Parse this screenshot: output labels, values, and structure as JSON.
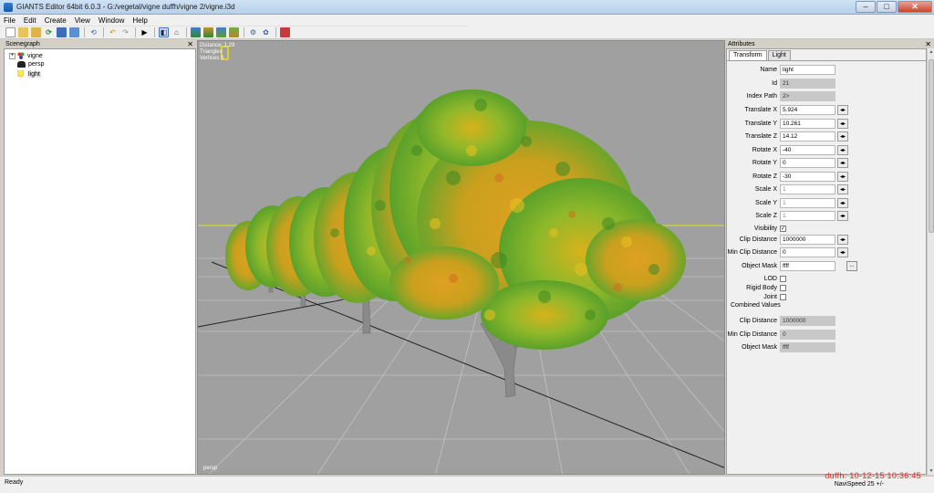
{
  "window": {
    "title": "GIANTS Editor 64bit 6.0.3 - G:/vegetal/vigne duffh/vigne 2/vigne.i3d",
    "minimize": "–",
    "maximize": "□",
    "close": "✕"
  },
  "menu": [
    "File",
    "Edit",
    "Create",
    "View",
    "Window",
    "Help"
  ],
  "toolbar": {
    "icons": [
      "new-file-icon",
      "open-folder-icon",
      "import-icon",
      "refresh-icon",
      "save-icon",
      "export-icon",
      "undo-history-icon",
      "undo-icon",
      "redo-icon",
      "play-icon",
      "select-icon",
      "lock-icon",
      "terrain-icon",
      "paint-icon",
      "foliage-icon",
      "tree-icon",
      "gear-icon",
      "material-icon",
      "camera-icon"
    ]
  },
  "scenegraph": {
    "title": "Scenegraph",
    "close": "✕",
    "items": [
      {
        "label": "vigne",
        "icon": "transform-group-icon",
        "expanded": false
      },
      {
        "label": "persp",
        "icon": "camera-icon"
      },
      {
        "label": "light",
        "icon": "light-bulb-icon",
        "selected": true
      }
    ]
  },
  "viewport": {
    "overlay": [
      "Distance: 1.29",
      "Triangles",
      "Vertices 0"
    ],
    "camera_label": "persp"
  },
  "attributes": {
    "title": "Attributes",
    "close": "✕",
    "tabs": [
      "Transform",
      "Light"
    ],
    "active_tab": "Transform",
    "fields": [
      {
        "label": "Name",
        "value": "light",
        "kind": "text"
      },
      {
        "label": "Id",
        "value": "21",
        "kind": "readonly"
      },
      {
        "label": "Index Path",
        "value": "2>",
        "kind": "readonly"
      },
      {
        "label": "Translate X",
        "value": "5.924",
        "kind": "spin"
      },
      {
        "label": "Translate Y",
        "value": "10.261",
        "kind": "spin"
      },
      {
        "label": "Translate Z",
        "value": "14.12",
        "kind": "spin"
      },
      {
        "label": "Rotate X",
        "value": "-40",
        "kind": "spin"
      },
      {
        "label": "Rotate Y",
        "value": "0",
        "kind": "spin"
      },
      {
        "label": "Rotate Z",
        "value": "-30",
        "kind": "spin"
      },
      {
        "label": "Scale X",
        "value": "1",
        "kind": "spin-disabled"
      },
      {
        "label": "Scale Y",
        "value": "1",
        "kind": "spin-disabled"
      },
      {
        "label": "Scale Z",
        "value": "1",
        "kind": "spin-disabled"
      },
      {
        "label": "Visibility",
        "value": "✓",
        "kind": "check"
      },
      {
        "label": "Clip Distance",
        "value": "1000000",
        "kind": "spin"
      },
      {
        "label": "Min Clip Distance",
        "value": "0",
        "kind": "spin"
      },
      {
        "label": "Object Mask",
        "value": "ffff",
        "kind": "mask"
      },
      {
        "label": "LOD",
        "value": "",
        "kind": "check"
      },
      {
        "label": "Rigid Body",
        "value": "",
        "kind": "check"
      },
      {
        "label": "Joint",
        "value": "",
        "kind": "check"
      }
    ],
    "combined_title": "Combined Values",
    "combined": [
      {
        "label": "Clip Distance",
        "value": "1000000"
      },
      {
        "label": "Min Clip Distance",
        "value": "0"
      },
      {
        "label": "Object Mask",
        "value": "ffff"
      }
    ],
    "mask_button": "..."
  },
  "status": {
    "text": "Ready",
    "navispeed": "NaviSpeed 25 +/-",
    "watermark": "duffh: 10-12-15 10:36:45"
  },
  "colors": {
    "viewport_bg": "#a0a0a0",
    "grid_line": "#c4c4c4",
    "horizon": "#e8e020",
    "foliage_green": "#5aa12a",
    "foliage_yellow": "#d7b21b",
    "foliage_orange": "#d07a1e",
    "trunk": "#8a8a8a"
  }
}
